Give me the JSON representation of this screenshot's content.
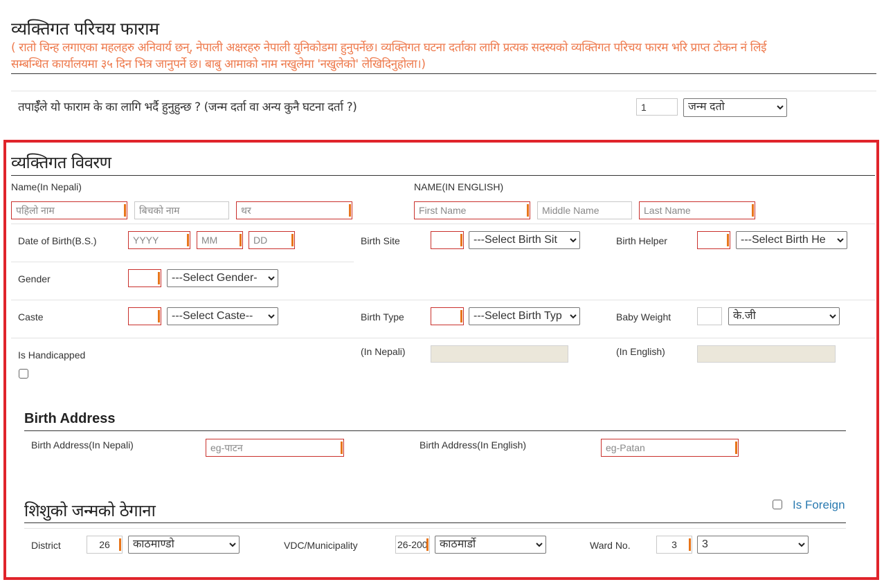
{
  "header": {
    "title": "व्यक्तिगत परिचय फाराम",
    "notice_line1": "(   रातो चिन्ह लगाएका महलहरु अनिवार्य छन्,  नेपाली अक्षरहरु नेपाली युनिकोडमा हुनुपर्नेछ। व्यक्तिगत घटना दर्ताका लागि प्रत्यक सदस्यको व्यक्तिगत परिचय फारम भरि प्राप्त टोकन नं लिई",
    "notice_line2": "सम्बन्धित कार्यालयमा ३५ दिन भित्र जानुपर्ने छ। बाबु आमाको नाम नखुलेमा 'नखुलेको' लेखिदिनुहोला।)"
  },
  "purpose": {
    "question": "तपाईँले यो फाराम के का लागि भर्दै हुनुहुन्छ ? (जन्म दर्ता वा अन्य कुनै घटना दर्ता ?)",
    "code_value": "1",
    "type_selected": "जन्म दतो"
  },
  "personal": {
    "section_title": "व्यक्तिगत विवरण",
    "name_nepali_label": "Name(In Nepali)",
    "name_nepali": {
      "first_placeholder": "पहिलो नाम",
      "middle_placeholder": "बिचको नाम",
      "last_placeholder": "थर"
    },
    "name_english_label": "NAME(IN ENGLISH)",
    "name_english": {
      "first_placeholder": "First Name",
      "middle_placeholder": "Middle Name",
      "last_placeholder": "Last Name"
    },
    "dob_label": "Date of Birth(B.S.)",
    "dob": {
      "year_placeholder": "YYYY",
      "month_placeholder": "MM",
      "day_placeholder": "DD"
    },
    "birth_site_label": "Birth Site",
    "birth_site_selected": "---Select Birth Sit",
    "birth_helper_label": "Birth Helper",
    "birth_helper_selected": "---Select Birth He",
    "gender_label": "Gender",
    "gender_selected": "---Select Gender-",
    "caste_label": "Caste",
    "caste_selected": "---Select Caste--",
    "birth_type_label": "Birth Type",
    "birth_type_selected": "---Select Birth Typ",
    "baby_weight_label": "Baby Weight",
    "baby_weight_value": "",
    "baby_weight_unit": "के.जी",
    "handicapped_label": "Is Handicapped",
    "handicapped_checked": false,
    "in_nepali_label": "(In Nepali)",
    "in_english_label": "(In English)"
  },
  "birth_address": {
    "title": "Birth Address",
    "nepali_label": "Birth Address(In Nepali)",
    "nepali_placeholder": "eg-पाटन",
    "english_label": "Birth Address(In English)",
    "english_placeholder": "eg-Patan"
  },
  "birth_place": {
    "title": "शिशुको जन्मको ठेगाना",
    "is_foreign_label": "Is Foreign",
    "is_foreign_checked": false,
    "district_label": "District",
    "district_code": "26",
    "district_selected": "काठमाण्डो",
    "vdc_label": "VDC/Municipality",
    "vdc_code": "26-200",
    "vdc_selected": "काठमार्डो",
    "ward_label": "Ward No.",
    "ward_code": "3",
    "ward_selected": "3"
  },
  "colors": {
    "required_border": "#c9302c",
    "required_marker": "#e8751a",
    "highlight_box": "#e0242b",
    "notice_text": "#ee7a4d",
    "link": "#2a7ab0",
    "readonly_bg": "#ebe7da"
  }
}
